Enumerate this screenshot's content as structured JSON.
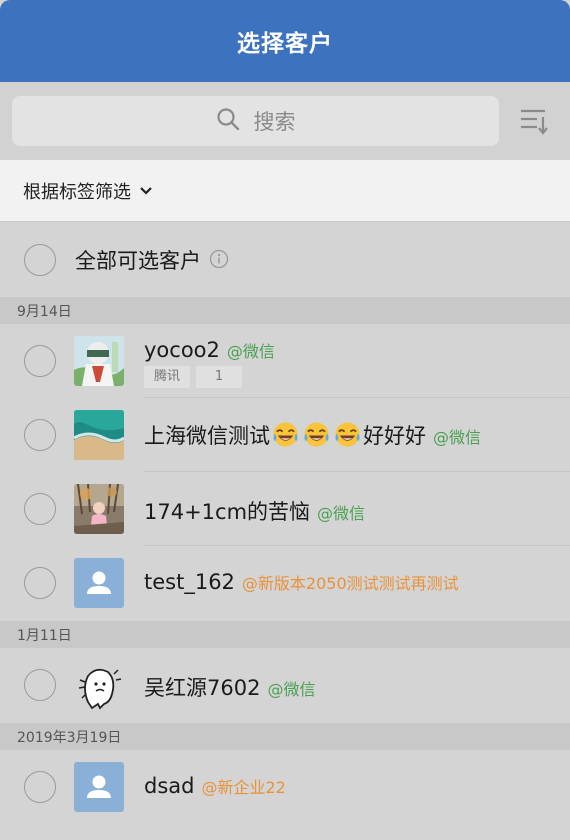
{
  "header": {
    "title": "选择客户"
  },
  "search": {
    "placeholder": "搜索"
  },
  "filter": {
    "label": "根据标签筛选"
  },
  "select_all": {
    "label": "全部可选客户"
  },
  "groups": [
    {
      "date": "9月14日",
      "rows": [
        {
          "name": "yocoo2",
          "tag": "@微信",
          "tag_color": "#4aa151",
          "chips": [
            "腾讯",
            "1"
          ],
          "avatar": "photo-avatar"
        },
        {
          "name_prefix": "上海微信测试",
          "name_suffix": "好好好",
          "emoji": "tears-of-joy",
          "tag": "@微信",
          "tag_color": "#4aa151",
          "avatar": "beach-avatar"
        },
        {
          "name": "174+1cm的苦恼",
          "tag": "@微信",
          "tag_color": "#4aa151",
          "avatar": "photo-avatar"
        },
        {
          "name": "test_162",
          "tag": "@新版本2050测试测试再测试",
          "tag_color": "#e8923a",
          "avatar": "default-user-avatar"
        }
      ]
    },
    {
      "date": "1月11日",
      "rows": [
        {
          "name": "吴红源7602",
          "tag": "@微信",
          "tag_color": "#4aa151",
          "avatar": "cartoon-avatar"
        }
      ]
    },
    {
      "date": "2019年3月19日",
      "rows": [
        {
          "name": "dsad",
          "tag": "@新企业22",
          "tag_color": "#e8923a",
          "avatar": "default-user-avatar"
        }
      ]
    }
  ],
  "colors": {
    "header_blue": "#3d72bf",
    "wechat_green": "#4aa151",
    "enterprise_orange": "#e8923a"
  }
}
